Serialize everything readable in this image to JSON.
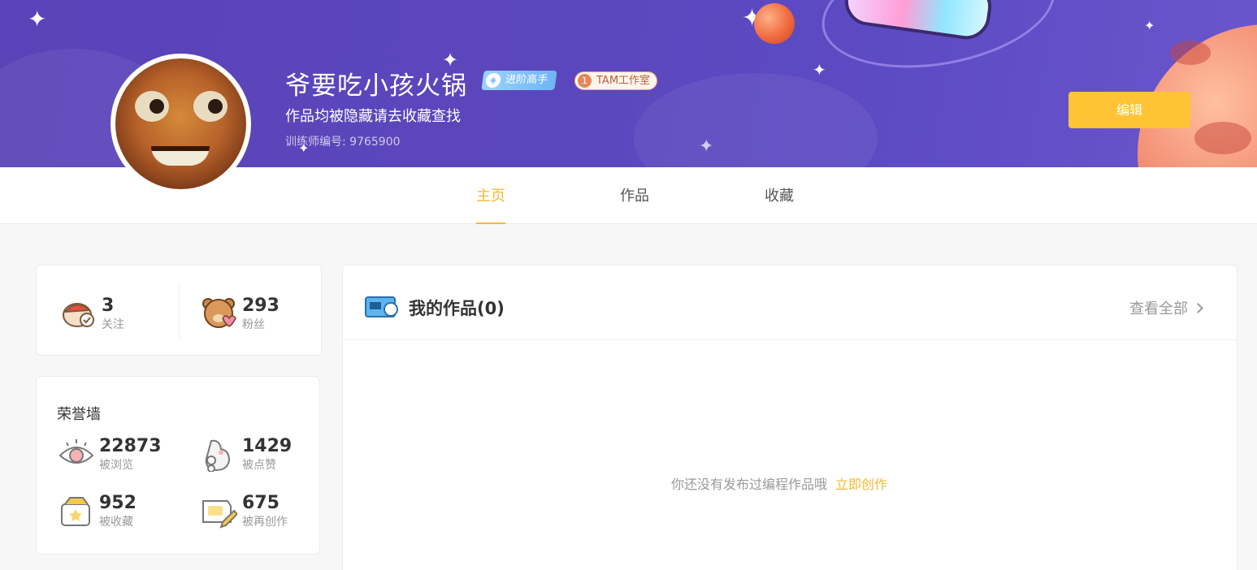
{
  "profile": {
    "name": "爷要吃小孩火锅",
    "level_badge": "进阶高手",
    "studio_badge_num": "1",
    "studio_badge": "TAM工作室",
    "bio": "作品均被隐藏请去收藏查找",
    "trainer_id": "训练师编号: 9765900",
    "edit_label": "编辑"
  },
  "tabs": [
    {
      "label": "主页",
      "active": true
    },
    {
      "label": "作品",
      "active": false
    },
    {
      "label": "收藏",
      "active": false
    }
  ],
  "social": {
    "follow": {
      "count": "3",
      "label": "关注",
      "icon": "follow-bird-icon"
    },
    "fans": {
      "count": "293",
      "label": "粉丝",
      "icon": "bear-heart-icon"
    }
  },
  "honor": {
    "title": "荣誉墙",
    "items": [
      {
        "count": "22873",
        "label": "被浏览",
        "icon": "eye-icon"
      },
      {
        "count": "1429",
        "label": "被点赞",
        "icon": "paw-like-icon"
      },
      {
        "count": "952",
        "label": "被收藏",
        "icon": "star-box-icon"
      },
      {
        "count": "675",
        "label": "被再创作",
        "icon": "pencil-card-icon"
      }
    ]
  },
  "works": {
    "title": "我的作品(0)",
    "view_all": "查看全部",
    "empty_text": "你还没有发布过编程作品哦",
    "create_link": "立即创作"
  },
  "colors": {
    "accent": "#f5b931",
    "button": "#fec433",
    "banner": "#5b47bd"
  }
}
